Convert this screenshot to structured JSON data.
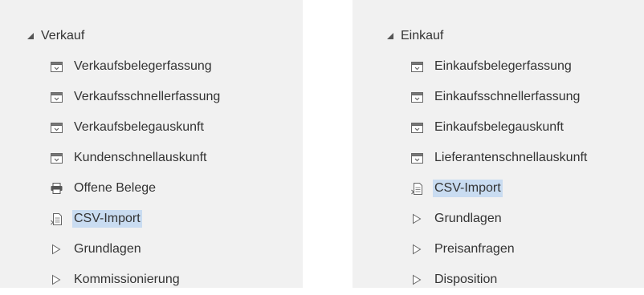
{
  "left": {
    "group": {
      "label": "Verkauf",
      "icon": "triangle-expanded-icon"
    },
    "items": [
      {
        "label": "Verkaufsbelegerfassung",
        "icon": "form-window-icon"
      },
      {
        "label": "Verkaufsschnellerfassung",
        "icon": "form-window-icon"
      },
      {
        "label": "Verkaufsbelegauskunft",
        "icon": "form-window-icon"
      },
      {
        "label": "Kundenschnellauskunft",
        "icon": "form-window-icon"
      },
      {
        "label": "Offene Belege",
        "icon": "printer-icon"
      },
      {
        "label": "CSV-Import",
        "icon": "import-document-icon",
        "selected": true
      },
      {
        "label": "Grundlagen",
        "icon": "triangle-collapsed-icon"
      },
      {
        "label": "Kommissionierung",
        "icon": "triangle-collapsed-icon"
      }
    ]
  },
  "right": {
    "group": {
      "label": "Einkauf",
      "icon": "triangle-expanded-icon"
    },
    "items": [
      {
        "label": "Einkaufsbelegerfassung",
        "icon": "form-window-icon"
      },
      {
        "label": "Einkaufsschnellerfassung",
        "icon": "form-window-icon"
      },
      {
        "label": "Einkaufsbelegauskunft",
        "icon": "form-window-icon"
      },
      {
        "label": "Lieferantenschnellauskunft",
        "icon": "form-window-icon"
      },
      {
        "label": "CSV-Import",
        "icon": "import-document-icon",
        "selected": true
      },
      {
        "label": "Grundlagen",
        "icon": "triangle-collapsed-icon"
      },
      {
        "label": "Preisanfragen",
        "icon": "triangle-collapsed-icon"
      },
      {
        "label": "Disposition",
        "icon": "triangle-collapsed-icon"
      }
    ]
  },
  "colors": {
    "panel_bg": "#f1f1f1",
    "selection": "#c9dcf1",
    "text": "#333333",
    "icon": "#555555"
  }
}
